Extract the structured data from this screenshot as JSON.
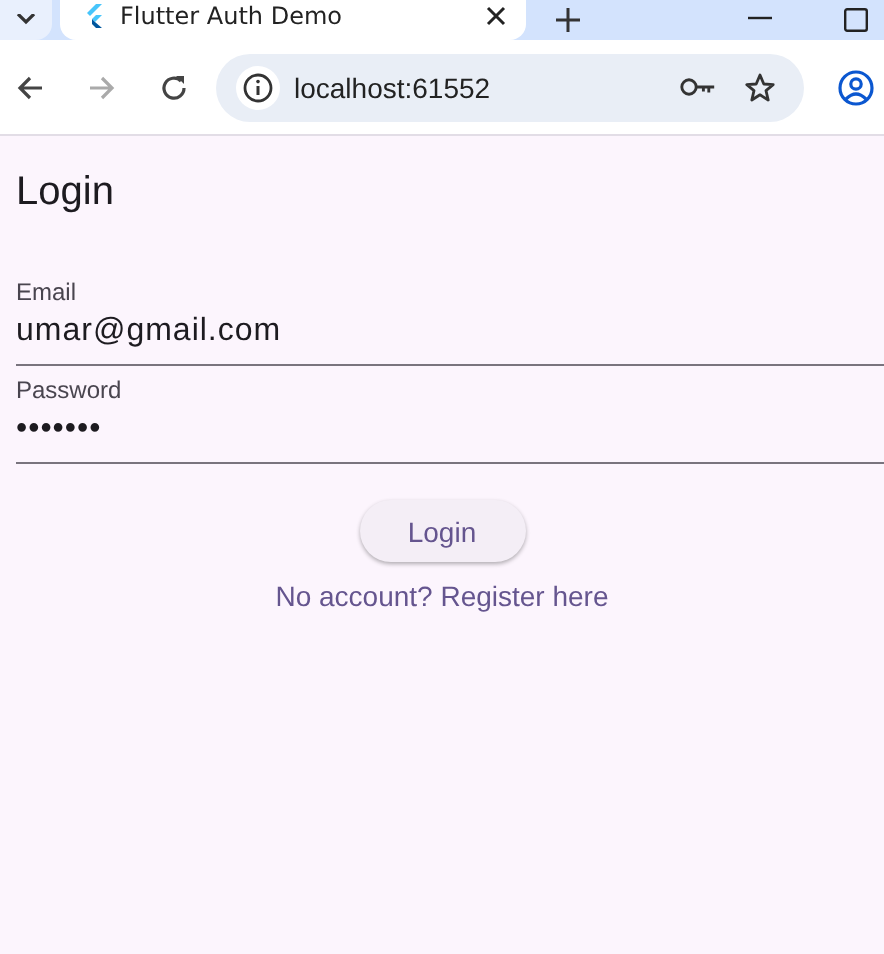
{
  "browser": {
    "tab_title": "Flutter Auth Demo",
    "url": "localhost:61552"
  },
  "page": {
    "title": "Login",
    "fields": [
      {
        "label": "Email",
        "value": "umar@gmail.com"
      },
      {
        "label": "Password",
        "value": "•••••••"
      }
    ],
    "button": "Login",
    "link": "No account? Register here"
  }
}
